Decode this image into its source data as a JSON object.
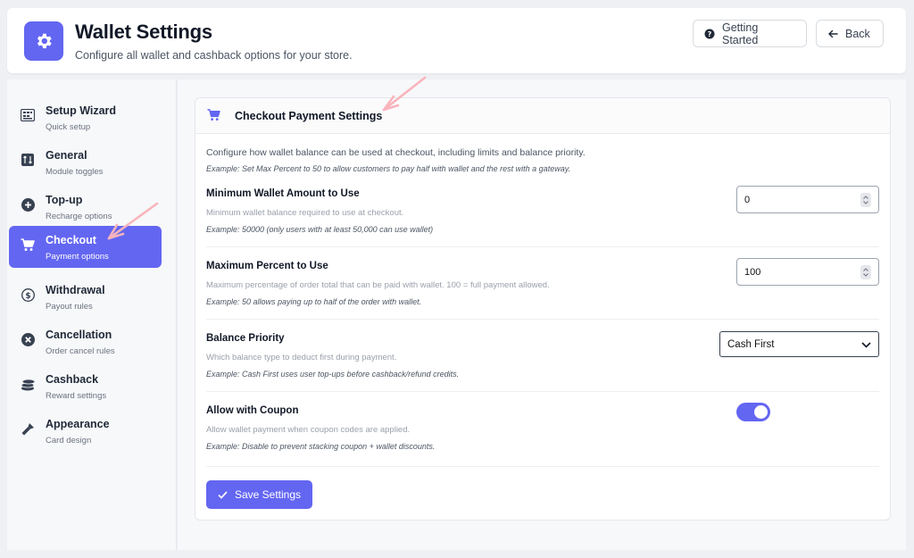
{
  "header": {
    "title": "Wallet Settings",
    "subtitle": "Configure all wallet and cashback options for your store.",
    "getting_started": "Getting Started",
    "back": "Back"
  },
  "sidebar": {
    "items": [
      {
        "label": "Setup Wizard",
        "sub": "Quick setup",
        "icon": "grid-icon"
      },
      {
        "label": "General",
        "sub": "Module toggles",
        "icon": "sliders-icon"
      },
      {
        "label": "Top-up",
        "sub": "Recharge options",
        "icon": "plus-circle-icon"
      },
      {
        "label": "Checkout",
        "sub": "Payment options",
        "icon": "cart-icon",
        "active": true
      },
      {
        "label": "Withdrawal",
        "sub": "Payout rules",
        "icon": "dollar-circle-icon"
      },
      {
        "label": "Cancellation",
        "sub": "Order cancel rules",
        "icon": "x-circle-icon"
      },
      {
        "label": "Cashback",
        "sub": "Reward settings",
        "icon": "coins-icon"
      },
      {
        "label": "Appearance",
        "sub": "Card design",
        "icon": "brush-icon"
      }
    ]
  },
  "card": {
    "title": "Checkout Payment Settings",
    "intro": "Configure how wallet balance can be used at checkout, including limits and balance priority.",
    "intro_example": "Example: Set Max Percent to 50 to allow customers to pay half with wallet and the rest with a gateway.",
    "fields": {
      "min_amount": {
        "label": "Minimum Wallet Amount to Use",
        "desc": "Minimum wallet balance required to use at checkout.",
        "example": "Example: 50000 (only users with at least 50,000 can use wallet)",
        "value": "0"
      },
      "max_percent": {
        "label": "Maximum Percent to Use",
        "desc": "Maximum percentage of order total that can be paid with wallet. 100 = full payment allowed.",
        "example": "Example: 50 allows paying up to half of the order with wallet.",
        "value": "100"
      },
      "priority": {
        "label": "Balance Priority",
        "desc": "Which balance type to deduct first during payment.",
        "example": "Example: Cash First uses user top-ups before cashback/refund credits.",
        "value": "Cash First"
      },
      "coupon": {
        "label": "Allow with Coupon",
        "desc": "Allow wallet payment when coupon codes are applied.",
        "example": "Example: Disable to prevent stacking coupon + wallet discounts.",
        "enabled": true
      }
    },
    "save_label": "Save Settings"
  },
  "colors": {
    "accent": "#6366f1",
    "annotation_arrow": "#f9b4bc"
  }
}
